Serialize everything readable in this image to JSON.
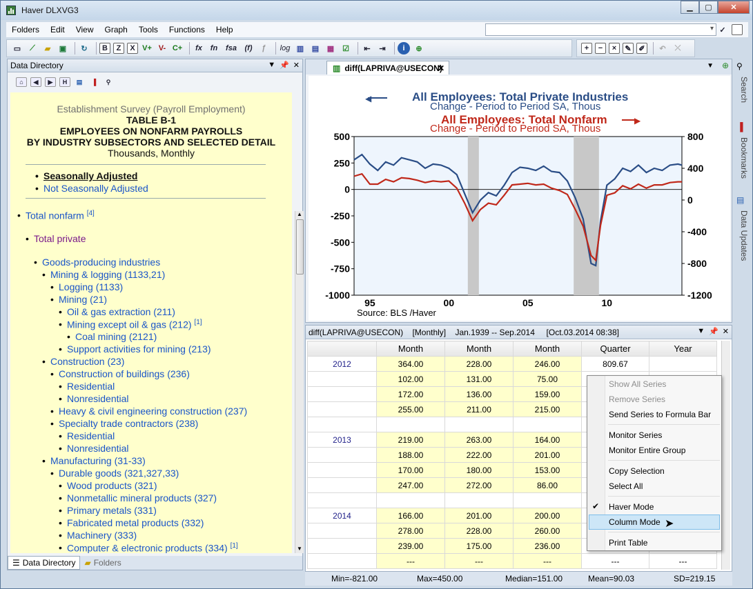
{
  "window": {
    "title": "Haver DLXVG3"
  },
  "menu": [
    "Folders",
    "Edit",
    "View",
    "Graph",
    "Tools",
    "Functions",
    "Help"
  ],
  "toolbar": {
    "b1": "B",
    "b2": "Z",
    "b3": "X",
    "v_plus": "V+",
    "v_minus": "V-",
    "c_plus": "C+",
    "fx": "fx",
    "fn": "fn",
    "fsa": "fsa",
    "f": "(f)",
    "log": "log"
  },
  "data_directory": {
    "title": "Data Directory",
    "header_lines": [
      "Establishment Survey (Payroll Employment)",
      "TABLE B-1",
      "EMPLOYEES ON NONFARM PAYROLLS",
      "BY INDUSTRY SUBSECTORS AND SELECTED DETAIL",
      "Thousands, Monthly"
    ],
    "links": [
      "Seasonally Adjusted",
      "Not Seasonally Adjusted"
    ],
    "tree": [
      {
        "label": "Total nonfarm",
        "sup": "[4]"
      },
      {
        "label": "Total private",
        "sup": ""
      },
      {
        "label": "Goods-producing industries",
        "sup": ""
      },
      {
        "label": "Mining & logging (1133,21)",
        "sup": ""
      },
      {
        "label": "Logging (1133)",
        "sup": ""
      },
      {
        "label": "Mining (21)",
        "sup": ""
      },
      {
        "label": "Oil & gas extraction (211)",
        "sup": ""
      },
      {
        "label": "Mining except oil & gas (212)",
        "sup": "[1]"
      },
      {
        "label": "Coal mining (2121)",
        "sup": ""
      },
      {
        "label": "Support activities for mining (213)",
        "sup": ""
      },
      {
        "label": "Construction (23)",
        "sup": ""
      },
      {
        "label": "Construction of buildings (236)",
        "sup": ""
      },
      {
        "label": "Residential",
        "sup": ""
      },
      {
        "label": "Nonresidential",
        "sup": ""
      },
      {
        "label": "Heavy & civil engineering construction (237)",
        "sup": ""
      },
      {
        "label": "Specialty trade contractors (238)",
        "sup": ""
      },
      {
        "label": "Residential",
        "sup": ""
      },
      {
        "label": "Nonresidential",
        "sup": ""
      },
      {
        "label": "Manufacturing (31-33)",
        "sup": ""
      },
      {
        "label": "Durable goods (321,327,33)",
        "sup": ""
      },
      {
        "label": "Wood products (321)",
        "sup": ""
      },
      {
        "label": "Nonmetallic mineral products (327)",
        "sup": ""
      },
      {
        "label": "Primary metals (331)",
        "sup": ""
      },
      {
        "label": "Fabricated metal products (332)",
        "sup": ""
      },
      {
        "label": "Machinery (333)",
        "sup": ""
      },
      {
        "label": "Computer & electronic products (334)",
        "sup": "[1]"
      }
    ],
    "tabs": [
      "Data Directory",
      "Folders"
    ]
  },
  "chart_tab": {
    "label": "diff(LAPRIVA@USECON)"
  },
  "chart_data": {
    "type": "line",
    "title_left": "All Employees: Total Private Industries",
    "subtitle_left": "Change - Period to Period    SA, Thous",
    "title_right": "All Employees: Total Nonfarm",
    "subtitle_right": "Change - Period to Period    SA, Thous",
    "source": "Source:  BLS /Haver",
    "left_axis": {
      "ticks": [
        "500",
        "250",
        "0",
        "-250",
        "-500",
        "-750",
        "-1000"
      ],
      "ylim": [
        -1000,
        500
      ]
    },
    "right_axis": {
      "ticks": [
        "800",
        "400",
        "0",
        "-400",
        "-800",
        "-1200"
      ],
      "ylim": [
        -1200,
        800
      ]
    },
    "x_ticks": [
      "95",
      "00",
      "05",
      "10"
    ],
    "xlim": [
      1994,
      2014.75
    ],
    "recessions": [
      [
        2001.2,
        2001.9
      ],
      [
        2007.9,
        2009.5
      ]
    ],
    "series": [
      {
        "name": "All Employees: Total Private Industries",
        "color": "#2a4d86",
        "axis": "left",
        "x": [
          1994,
          1994.5,
          1995,
          1995.5,
          1996,
          1996.5,
          1997,
          1997.5,
          1998,
          1998.5,
          1999,
          1999.5,
          2000,
          2000.5,
          2001,
          2001.5,
          2002,
          2002.5,
          2003,
          2003.5,
          2004,
          2004.5,
          2005,
          2005.5,
          2006,
          2006.5,
          2007,
          2007.5,
          2008,
          2008.5,
          2009,
          2009.3,
          2009.6,
          2010,
          2010.5,
          2011,
          2011.5,
          2012,
          2012.5,
          2013,
          2013.5,
          2014,
          2014.5,
          2014.75
        ],
        "values": [
          280,
          330,
          240,
          180,
          260,
          230,
          300,
          280,
          260,
          200,
          240,
          230,
          200,
          140,
          -40,
          -220,
          -100,
          -30,
          -60,
          40,
          160,
          210,
          200,
          180,
          220,
          170,
          160,
          80,
          -80,
          -280,
          -700,
          -720,
          -300,
          40,
          100,
          200,
          170,
          230,
          160,
          200,
          180,
          230,
          240,
          230
        ]
      },
      {
        "name": "All Employees: Total Nonfarm",
        "color": "#c0281a",
        "axis": "right",
        "x": [
          1994,
          1994.5,
          1995,
          1995.5,
          1996,
          1996.5,
          1997,
          1997.5,
          1998,
          1998.5,
          1999,
          1999.5,
          2000,
          2000.5,
          2001,
          2001.5,
          2002,
          2002.5,
          2003,
          2003.5,
          2004,
          2004.5,
          2005,
          2005.5,
          2006,
          2006.5,
          2007,
          2007.5,
          2008,
          2008.5,
          2009,
          2009.3,
          2009.6,
          2010,
          2010.5,
          2011,
          2011.5,
          2012,
          2012.5,
          2013,
          2013.5,
          2014,
          2014.5,
          2014.75
        ],
        "values": [
          300,
          330,
          200,
          200,
          260,
          230,
          280,
          270,
          250,
          220,
          240,
          230,
          240,
          150,
          -40,
          -260,
          -120,
          -40,
          -60,
          60,
          190,
          200,
          210,
          190,
          200,
          150,
          120,
          70,
          -120,
          -330,
          -700,
          -760,
          -320,
          60,
          90,
          180,
          140,
          200,
          150,
          190,
          190,
          220,
          230,
          230
        ]
      }
    ]
  },
  "grid": {
    "header": "diff(LAPRIVA@USECON)    [Monthly]    Jan.1939 -- Sep.2014     [Oct.03.2014 08:38]",
    "columns": [
      "",
      "Month",
      "Month",
      "Month",
      "Quarter",
      "Year"
    ],
    "rows": [
      [
        "2012",
        "364.00",
        "228.00",
        "246.00",
        "809.67",
        ""
      ],
      [
        "",
        "102.00",
        "131.00",
        "75.00",
        "",
        ""
      ],
      [
        "",
        "172.00",
        "136.00",
        "159.00",
        "",
        ""
      ],
      [
        "",
        "255.00",
        "211.00",
        "215.00",
        "",
        ""
      ],
      [
        "",
        "",
        "",
        "",
        "",
        ""
      ],
      [
        "2013",
        "219.00",
        "263.00",
        "164.00",
        "",
        ""
      ],
      [
        "",
        "188.00",
        "222.00",
        "201.00",
        "",
        ""
      ],
      [
        "",
        "170.00",
        "180.00",
        "153.00",
        "",
        ""
      ],
      [
        "",
        "247.00",
        "272.00",
        "86.00",
        "",
        ""
      ],
      [
        "",
        "",
        "",
        "",
        "",
        ""
      ],
      [
        "2014",
        "166.00",
        "201.00",
        "200.00",
        "",
        ""
      ],
      [
        "",
        "278.00",
        "228.00",
        "260.00",
        "",
        ""
      ],
      [
        "",
        "239.00",
        "175.00",
        "236.00",
        "",
        ""
      ],
      [
        "",
        "---",
        "---",
        "---",
        "---",
        "---"
      ]
    ]
  },
  "context_menu": {
    "items": [
      "Show All Series",
      "Remove Series",
      "Send Series to Formula Bar",
      "Monitor Series",
      "Monitor Entire Group",
      "Copy Selection",
      "Select All",
      "Haver Mode",
      "Column Mode",
      "Print Table"
    ]
  },
  "status": {
    "min": "Min=-821.00",
    "max": "Max=450.00",
    "median": "Median=151.00",
    "mean": "Mean=90.03",
    "sd": "SD=219.15"
  },
  "right_tabs": [
    "Search",
    "Bookmarks",
    "Data Updates"
  ]
}
